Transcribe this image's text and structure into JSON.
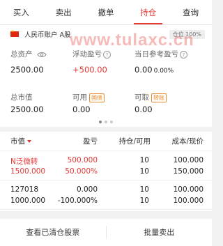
{
  "tabs": [
    "买入",
    "卖出",
    "撤单",
    "持仓",
    "查询"
  ],
  "account": {
    "name": "人民币账户 A股",
    "position_ratio": "仓位 100%"
  },
  "watermark": "www.tulaxc.cn",
  "summary": {
    "total_assets_label": "总资产",
    "total_assets": "2500.00",
    "floating_pl_label": "浮动盈亏",
    "floating_pl": "+500.00",
    "today_pl_label": "当日参考盈亏",
    "today_pl": "0.00",
    "today_pl_pct": "0.00%",
    "market_value_label": "总市值",
    "market_value": "2500.00",
    "available_label": "可用",
    "available": "0.00",
    "available_link": "国债",
    "withdrawable_label": "可取",
    "withdrawable": "0.00",
    "withdrawable_link": "转账"
  },
  "table": {
    "headers": {
      "market_value": "市值",
      "pl": "盈亏",
      "holding": "持仓/可用",
      "cost": "成本/现价"
    },
    "rows": [
      {
        "name": "N泛微转",
        "market_value": "1500.000",
        "pl": "500.000",
        "pl_pct": "50.000%",
        "holding": "10",
        "available": "10",
        "cost": "100.000",
        "price": "150.000"
      },
      {
        "name": "127018",
        "market_value": "1000.000",
        "pl": "0.000",
        "pl_pct": "-100.000%",
        "holding": "10",
        "available": "10",
        "cost": "100.000",
        "price": "100.000"
      }
    ]
  },
  "footer": {
    "cleared": "查看已清仓股票",
    "batch_sell": "批量卖出"
  },
  "colors": {
    "accent": "#e53935",
    "link": "#e8892b"
  },
  "icons": [
    "eye-icon",
    "help-icon",
    "flag-icon",
    "sort-down-icon"
  ]
}
